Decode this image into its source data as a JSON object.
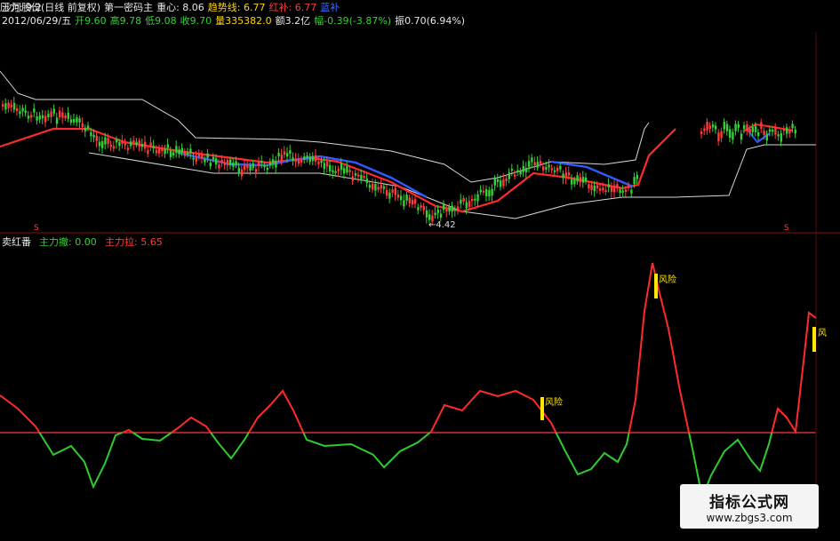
{
  "header": {
    "title": "沙河股份(日线 前复权)",
    "indicator1_name": "第一密码主",
    "center_label": "重心: 8.06",
    "trend_label": "趋势线: 6.77",
    "red_label": "红补: 6.77",
    "blue_label": "蓝补",
    "pressure_label": "压力: 9.2",
    "date": "2012/06/29/五",
    "open": "开9.60",
    "high": "高9.78",
    "low": "低9.08",
    "close": "收9.70",
    "volume": "量335382.0",
    "amount": "额3.2亿",
    "change": "幅-0.39(-3.87%)",
    "amplitude": "振0.70(6.94%)"
  },
  "price_panel": {
    "low_marker": "←4.42",
    "s_marker_left": "S",
    "s_marker_right": "S"
  },
  "indicator_panel": {
    "name": "卖红番",
    "main_dump": "主力撤: 0.00",
    "main_pull": "主力拉: 5.65"
  },
  "risk_labels": [
    "风险",
    "风险",
    "风"
  ],
  "watermark": {
    "cn": "指标公式网",
    "url": "www.zbgs3.com"
  },
  "colors": {
    "background": "#000000",
    "up": "#ff3b3b",
    "down": "#34d134",
    "mavg_blue": "#2f5bff",
    "envelope": "#d8d8d8",
    "risk_marker": "#ffe600"
  },
  "chart_data": {
    "type": "line",
    "series": [
      {
        "name": "主力拉",
        "values": [
          5.65
        ]
      }
    ]
  }
}
